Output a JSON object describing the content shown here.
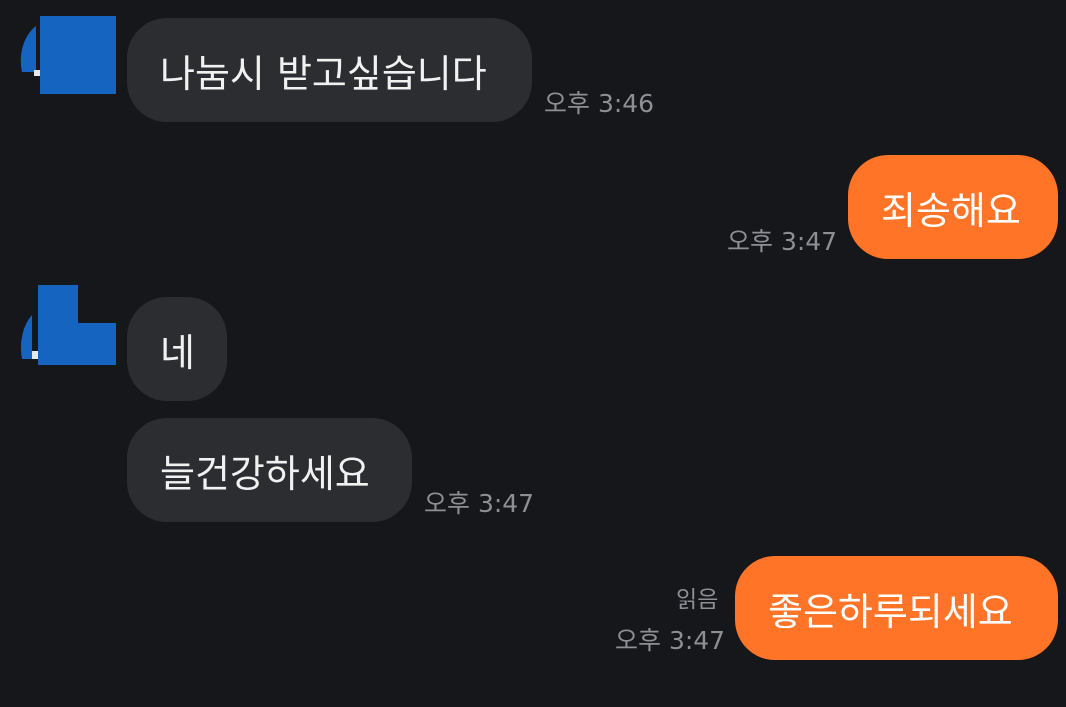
{
  "messages": [
    {
      "side": "in",
      "text": "나눔시 받고싶습니다",
      "time": "오후 3:46"
    },
    {
      "side": "out",
      "text": "죄송해요",
      "time": "오후 3:47"
    },
    {
      "side": "in",
      "text": "네",
      "time": ""
    },
    {
      "side": "in",
      "text": "늘건강하세요",
      "time": "오후 3:47"
    },
    {
      "side": "out",
      "text": "좋은하루되세요",
      "time": "오후 3:47",
      "status": "읽음"
    }
  ],
  "colors": {
    "background": "#16171b",
    "incoming_bubble": "#2b2d31",
    "outgoing_bubble": "#ff7426",
    "timestamp": "#8d8f94",
    "avatar_blue": "#1565c0"
  }
}
